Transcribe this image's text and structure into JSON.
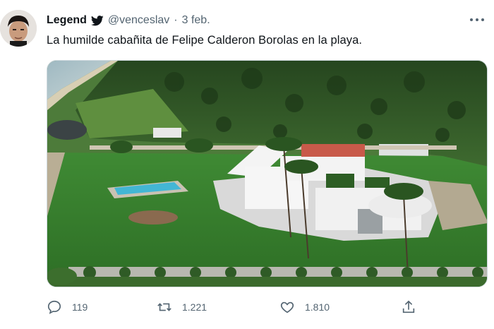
{
  "tweet": {
    "display_name": "Legend",
    "handle": "@venceslav",
    "separator": "·",
    "date": "3 feb.",
    "text": "La humilde cabañita de Felipe Calderon Borolas en la playa.",
    "image_description_icon": "photo"
  },
  "actions": {
    "reply_count": "119",
    "retweet_count": "1.221",
    "like_count": "1.810"
  },
  "icons": {
    "verified_bird": "bird-icon",
    "more": "more-icon",
    "reply": "reply-icon",
    "retweet": "retweet-icon",
    "like": "like-icon",
    "share": "share-icon"
  },
  "colors": {
    "text": "#0f1419",
    "secondary": "#536471",
    "twitter_blue": "#1d9bf0"
  }
}
